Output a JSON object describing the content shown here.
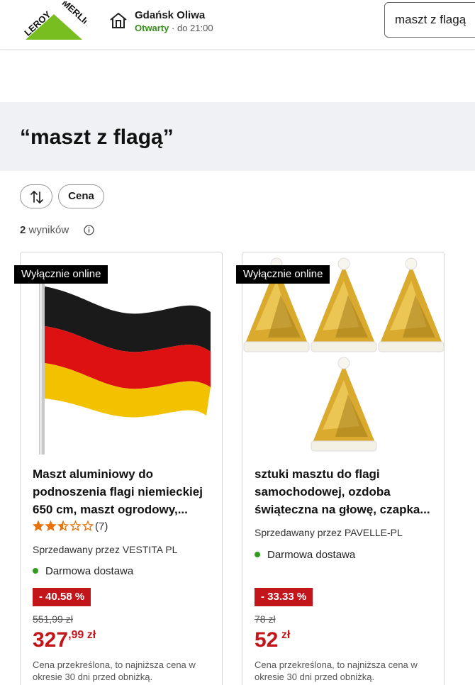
{
  "header": {
    "logo_text": "LEROY MERLIN",
    "store_name": "Gdańsk Oliwa",
    "store_open": "Otwarty",
    "store_hours": " · do 21:00",
    "search_value": "maszt z flagą"
  },
  "title": "“maszt z flagą”",
  "filters": {
    "sort_icon": "sort-arrows-icon",
    "price_label": "Cena"
  },
  "results": {
    "count": "2",
    "label": " wyników"
  },
  "colors": {
    "brand_green": "#78be20",
    "sale_red": "#c2161b",
    "delivery_green": "#2f9c1e",
    "star_orange": "#e8730c"
  },
  "products": [
    {
      "badge": "Wyłącznie online",
      "title": "Maszt aluminiowy do podnoszenia flagi niemieckiej 650 cm, maszt ogrodowy,...",
      "rating": 2.5,
      "reviews": "(7)",
      "seller": "Sprzedawany przez VESTITA PL",
      "delivery": "Darmowa dostawa",
      "discount": "- 40.58 %",
      "old_price": "551,99 zł",
      "price_main": "327",
      "price_sup": ",99 zł",
      "note": "Cena przekreślona, to najniższa cena w okresie 30 dni przed obniżką."
    },
    {
      "badge": "Wyłącznie online",
      "title": "sztuki masztu do flagi samochodowej, ozdoba świąteczna na głowę, czapka...",
      "seller": "Sprzedawany przez PAVELLE-PL",
      "delivery": "Darmowa dostawa",
      "discount": "- 33.33 %",
      "old_price": "78 zł",
      "price_main": "52",
      "price_sup": " zł",
      "note": "Cena przekreślona, to najniższa cena w okresie 30 dni przed obniżką."
    }
  ]
}
